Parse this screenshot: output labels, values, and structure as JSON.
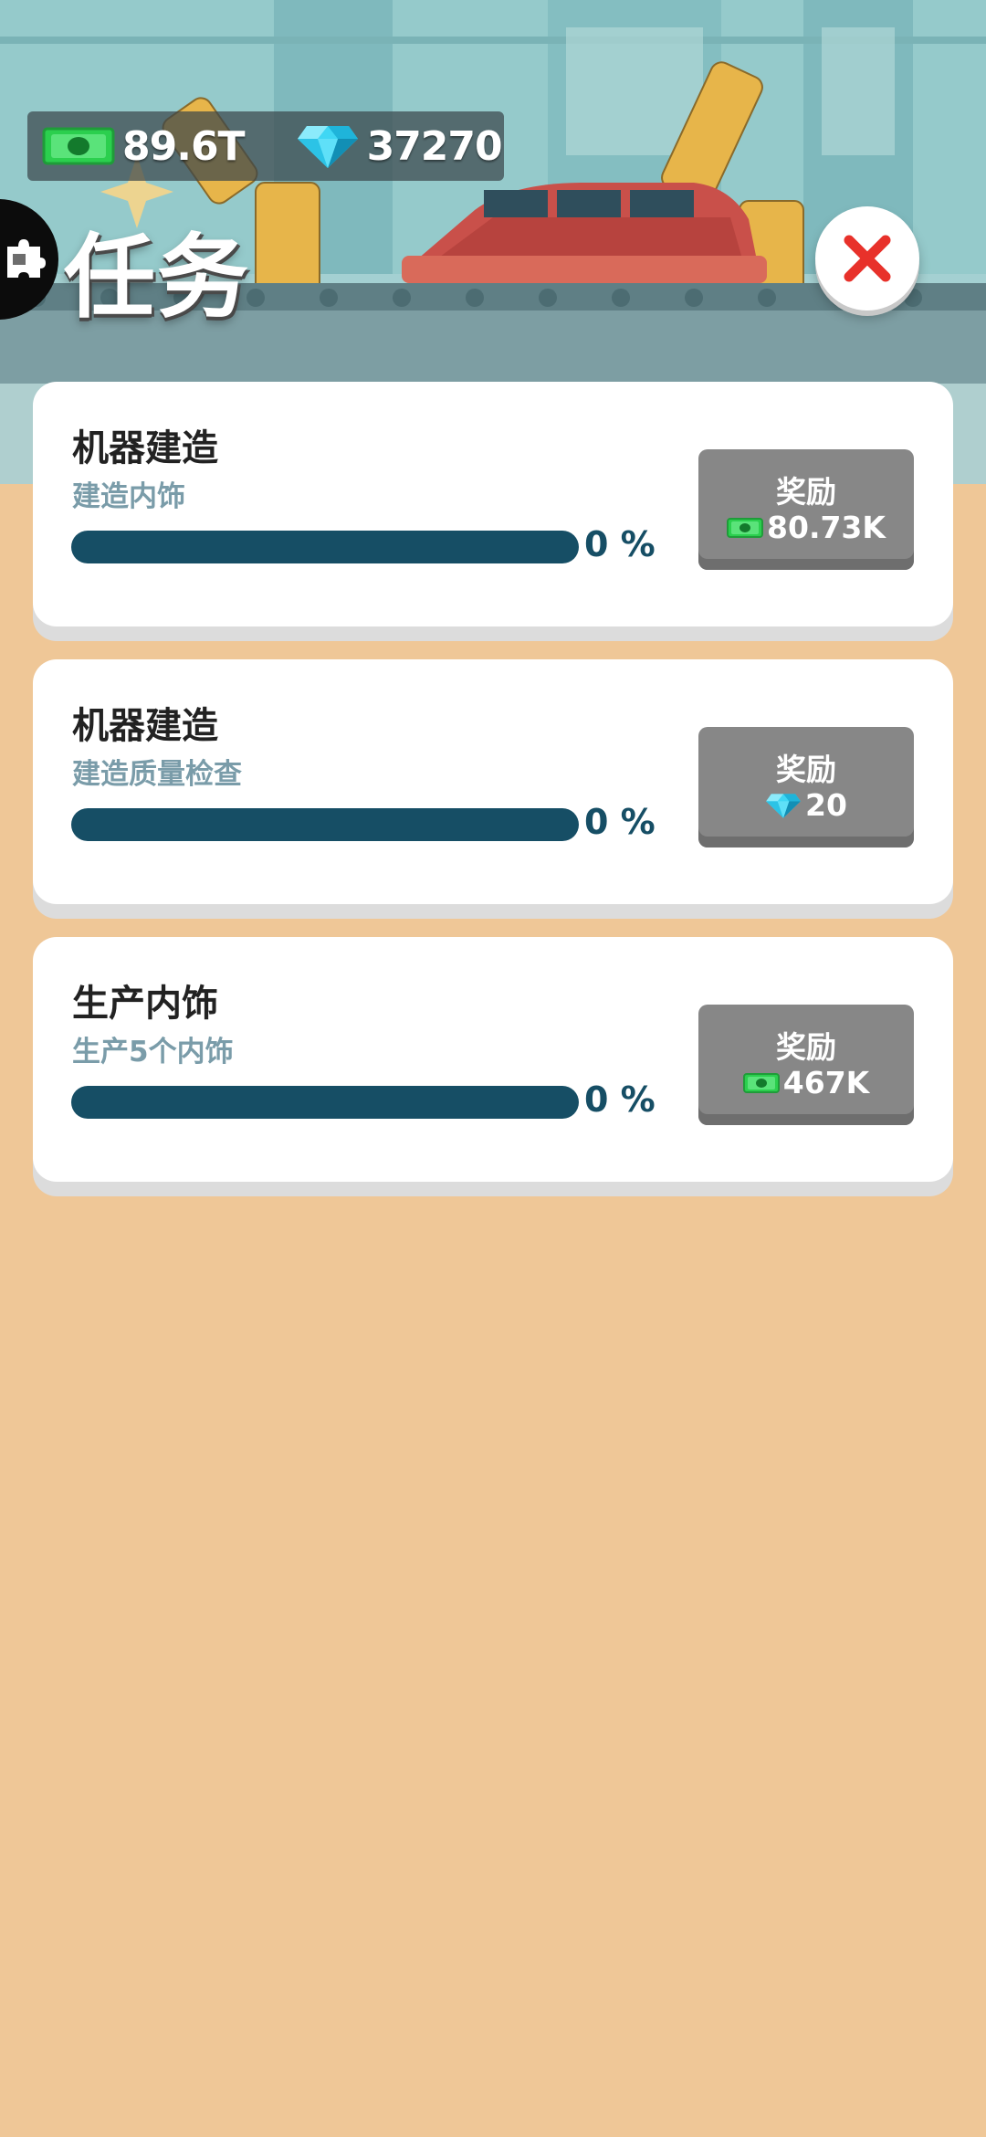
{
  "currency": {
    "cash": "89.6T",
    "gems": "37270",
    "cash_icon": "cash-icon",
    "gem_icon": "diamond-icon"
  },
  "side_tab": {
    "icon": "puzzle-icon"
  },
  "title": "任务",
  "close_icon": "close-icon",
  "missions": [
    {
      "title": "机器建造",
      "subtitle": "建造内饰",
      "progress": 0,
      "progress_text": "0 %",
      "reward_label": "奖励",
      "reward_icon": "cash-icon",
      "reward_value": "80.73K"
    },
    {
      "title": "机器建造",
      "subtitle": "建造质量检查",
      "progress": 0,
      "progress_text": "0 %",
      "reward_label": "奖励",
      "reward_icon": "diamond-icon",
      "reward_value": "20"
    },
    {
      "title": "生产内饰",
      "subtitle": "生产5个内饰",
      "progress": 0,
      "progress_text": "0 %",
      "reward_label": "奖励",
      "reward_icon": "cash-icon",
      "reward_value": "467K"
    }
  ],
  "colors": {
    "background": "#EFC797",
    "progress_track": "#164E65",
    "subtitle": "#7A9CA9",
    "reward_button": "#878787",
    "close_x": "#E8312A"
  }
}
